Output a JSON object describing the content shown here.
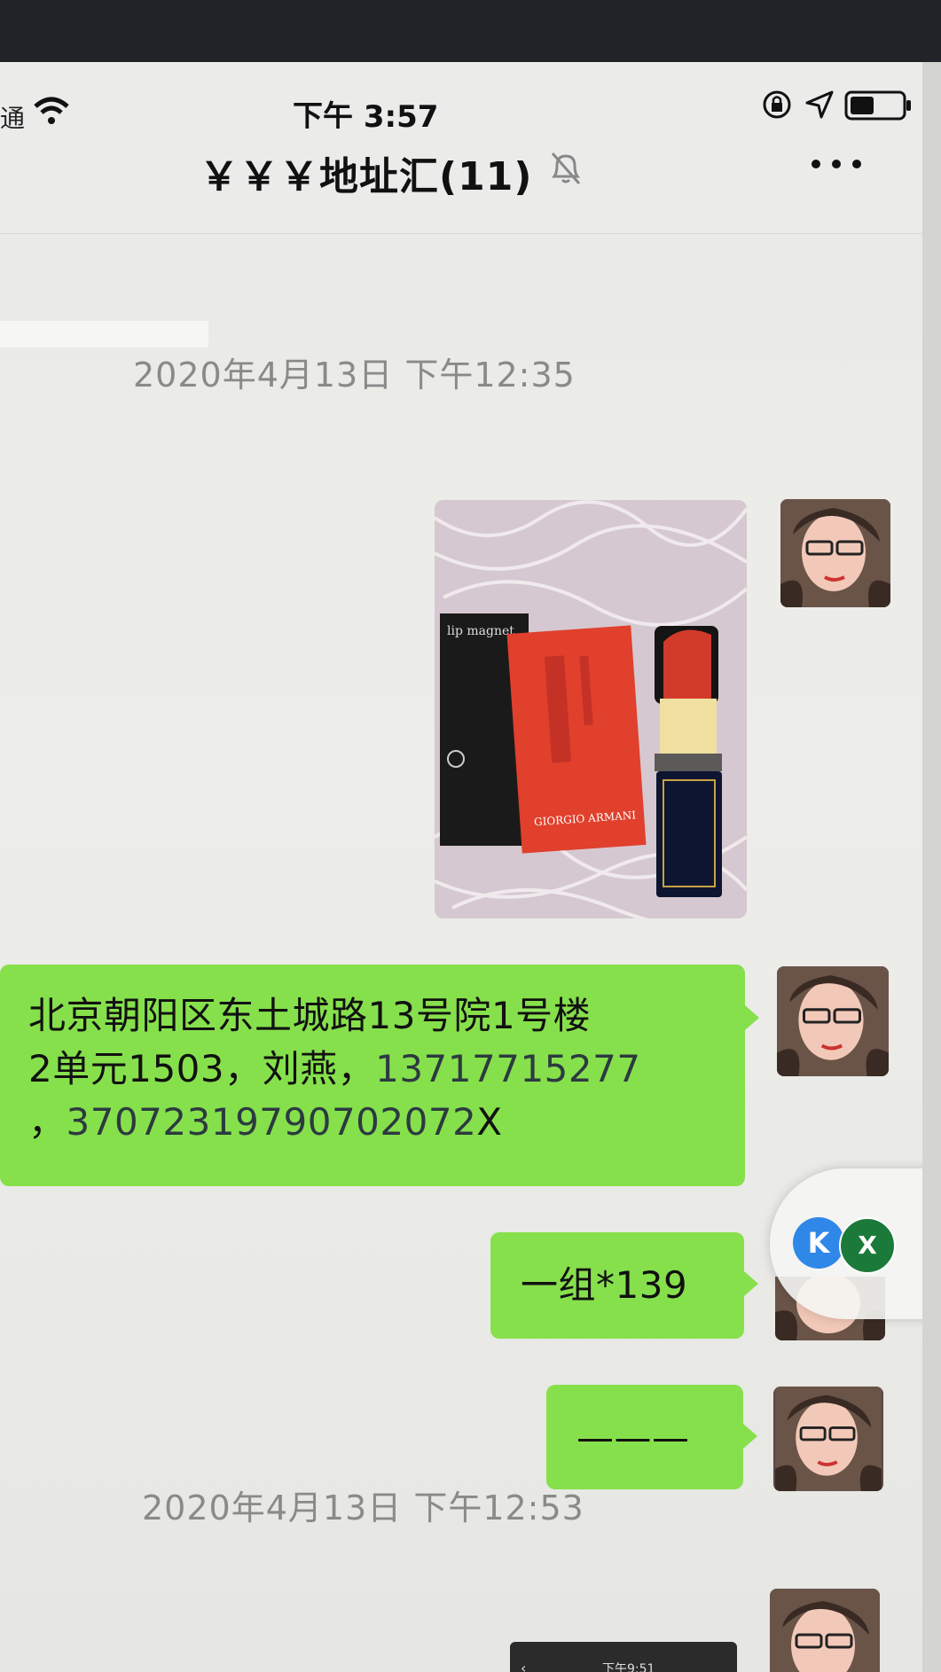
{
  "status_bar": {
    "carrier": "通",
    "time": "下午 3:57"
  },
  "nav": {
    "title": "￥￥￥地址汇(11)"
  },
  "timestamps": {
    "first": "2020年4月13日 下午12:35",
    "second": "2020年4月13日 下午12:53"
  },
  "messages": {
    "address_line1": "北京朝阳区东土城路13号院1号楼",
    "address_line2_a": "2单元1503，刘燕，",
    "address_line2_b": "13717715277",
    "address_line3_a": "，",
    "address_line3_b": "37072319790702072",
    "address_line3_c": "X",
    "group_msg": "一组*139",
    "dash_msg": "———"
  },
  "photo": {
    "box_text": "lip magnet",
    "brand": "GIORGIO ARMANI"
  },
  "mini_photo": {
    "time": "下午9:51",
    "back": "‹"
  },
  "float_widget": {
    "k_label": "K",
    "x_label": "X"
  },
  "colors": {
    "bubble_green": "#86e04c",
    "background": "#ebebea"
  }
}
